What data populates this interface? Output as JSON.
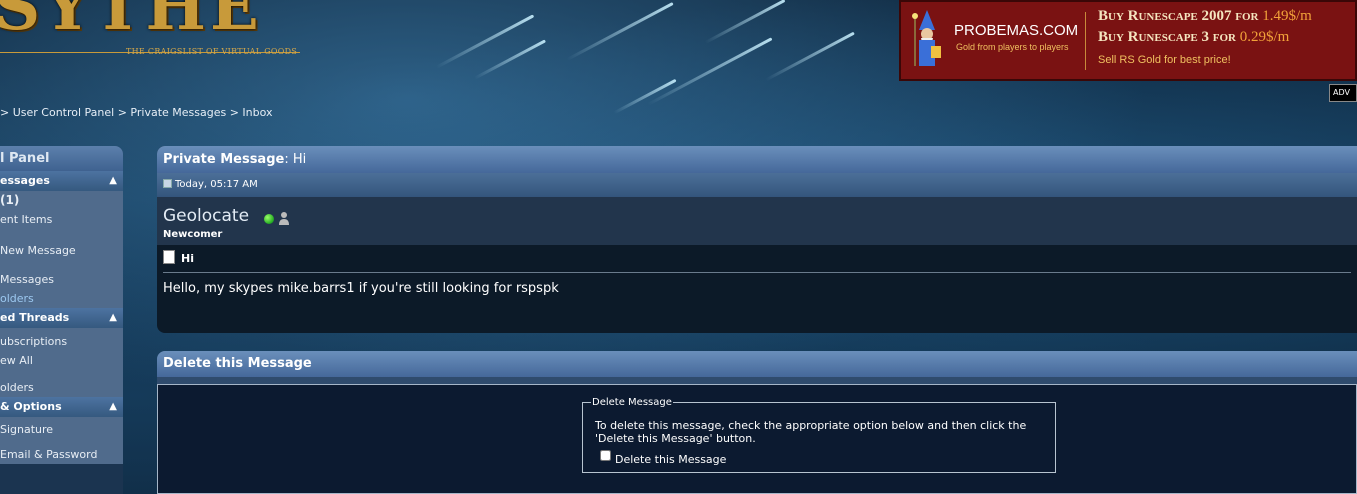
{
  "header": {
    "logo_text": "SYTHE",
    "logo_tagline": "THE CRAIGSLIST OF VIRTUAL GOODS"
  },
  "ad": {
    "site": "PROBEMAS.COM",
    "site_sub": "Gold from players to players",
    "line1_text": "Buy Runescape 2007 for ",
    "line1_price": "1.49$/m",
    "line2_text": "Buy Runescape 3 for ",
    "line2_price": "0.29$/m",
    "sell_text": "Sell RS Gold for best price!",
    "badge": "ADV"
  },
  "breadcrumb": "> User Control Panel > Private Messages > Inbox",
  "sidebar": {
    "title": "l Panel",
    "sections": [
      {
        "header": "essages",
        "items": [
          {
            "label": "(1)",
            "style": "bold"
          },
          {
            "label": "ent Items",
            "style": "normal"
          },
          {
            "label": "",
            "style": "spacer"
          },
          {
            "label": " New Message",
            "style": "normal"
          },
          {
            "label": "",
            "style": "spacer"
          },
          {
            "label": " Messages",
            "style": "normal"
          },
          {
            "label": "olders",
            "style": "link"
          }
        ]
      },
      {
        "header": "ed Threads",
        "items": [
          {
            "label": "ubscriptions",
            "style": "normal"
          },
          {
            "label": "ew All",
            "style": "normal"
          },
          {
            "label": "",
            "style": "spacer"
          },
          {
            "label": "olders",
            "style": "normal"
          }
        ]
      },
      {
        "header": "& Options",
        "items": [
          {
            "label": "Signature",
            "style": "normal"
          },
          {
            "label": "",
            "style": "spacer"
          },
          {
            "label": "Email & Password",
            "style": "normal"
          }
        ]
      }
    ]
  },
  "private_message": {
    "title_label": "Private Message",
    "title_subject": ": Hi",
    "date": "Today, 05:17 AM",
    "sender": "Geolocate",
    "sender_rank": "Newcomer",
    "subject": "Hi",
    "body": "Hello, my skypes mike.barrs1 if you're still looking for rspspk"
  },
  "delete_panel": {
    "title": "Delete this Message",
    "legend": "Delete Message",
    "instructions": "To delete this message, check the appropriate option below and then click the 'Delete this Message' button.",
    "checkbox_label": "Delete this Message"
  }
}
